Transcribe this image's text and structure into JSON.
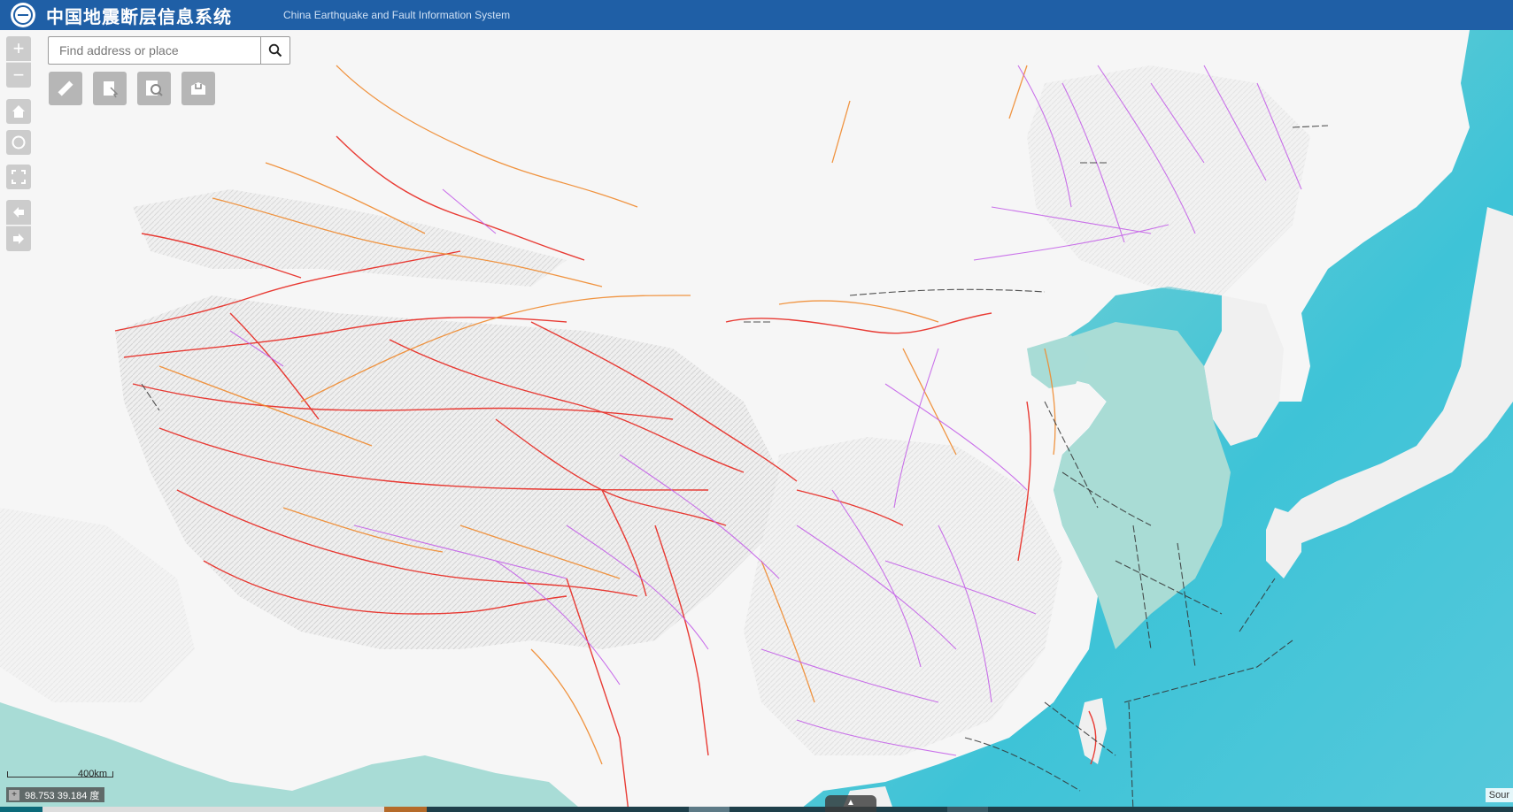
{
  "header": {
    "title_cn": "中国地震断层信息系统",
    "title_en": "China Earthquake and Fault Information System",
    "background_color": "#1f5fa6",
    "logo_icon": "globe-logo-icon"
  },
  "search": {
    "placeholder": "Find address or place",
    "value": "",
    "button_icon": "search-icon"
  },
  "map_controls": {
    "zoom_in_label": "+",
    "zoom_out_label": "−",
    "home_icon": "home-icon",
    "locate_icon": "locate-icon",
    "fullscreen_icon": "fullscreen-icon",
    "back_icon": "arrow-left-icon",
    "forward_icon": "arrow-right-icon"
  },
  "toolbar": {
    "tools": [
      {
        "icon": "ruler-icon",
        "name": "measure"
      },
      {
        "icon": "identify-icon",
        "name": "identify"
      },
      {
        "icon": "search-map-icon",
        "name": "query"
      },
      {
        "icon": "basemap-icon",
        "name": "basemap"
      }
    ]
  },
  "scale": {
    "label": "400km"
  },
  "coordinates": {
    "icon_label": "+",
    "text": "98.753 39.184 度"
  },
  "attribution": {
    "text": "Sour"
  },
  "bottom_toggle": {
    "label": "▲"
  },
  "map_colors": {
    "ocean_deep": "#37c2d6",
    "ocean_shallow": "#a8dcd6",
    "land": "#f4f4f4",
    "relief": "#cfcfcf",
    "fault_holocene": "#e8312a",
    "fault_late_pleistocene": "#f08a2e",
    "fault_pre_quaternary": "#c25ae8",
    "fault_offshore": "#333333"
  }
}
